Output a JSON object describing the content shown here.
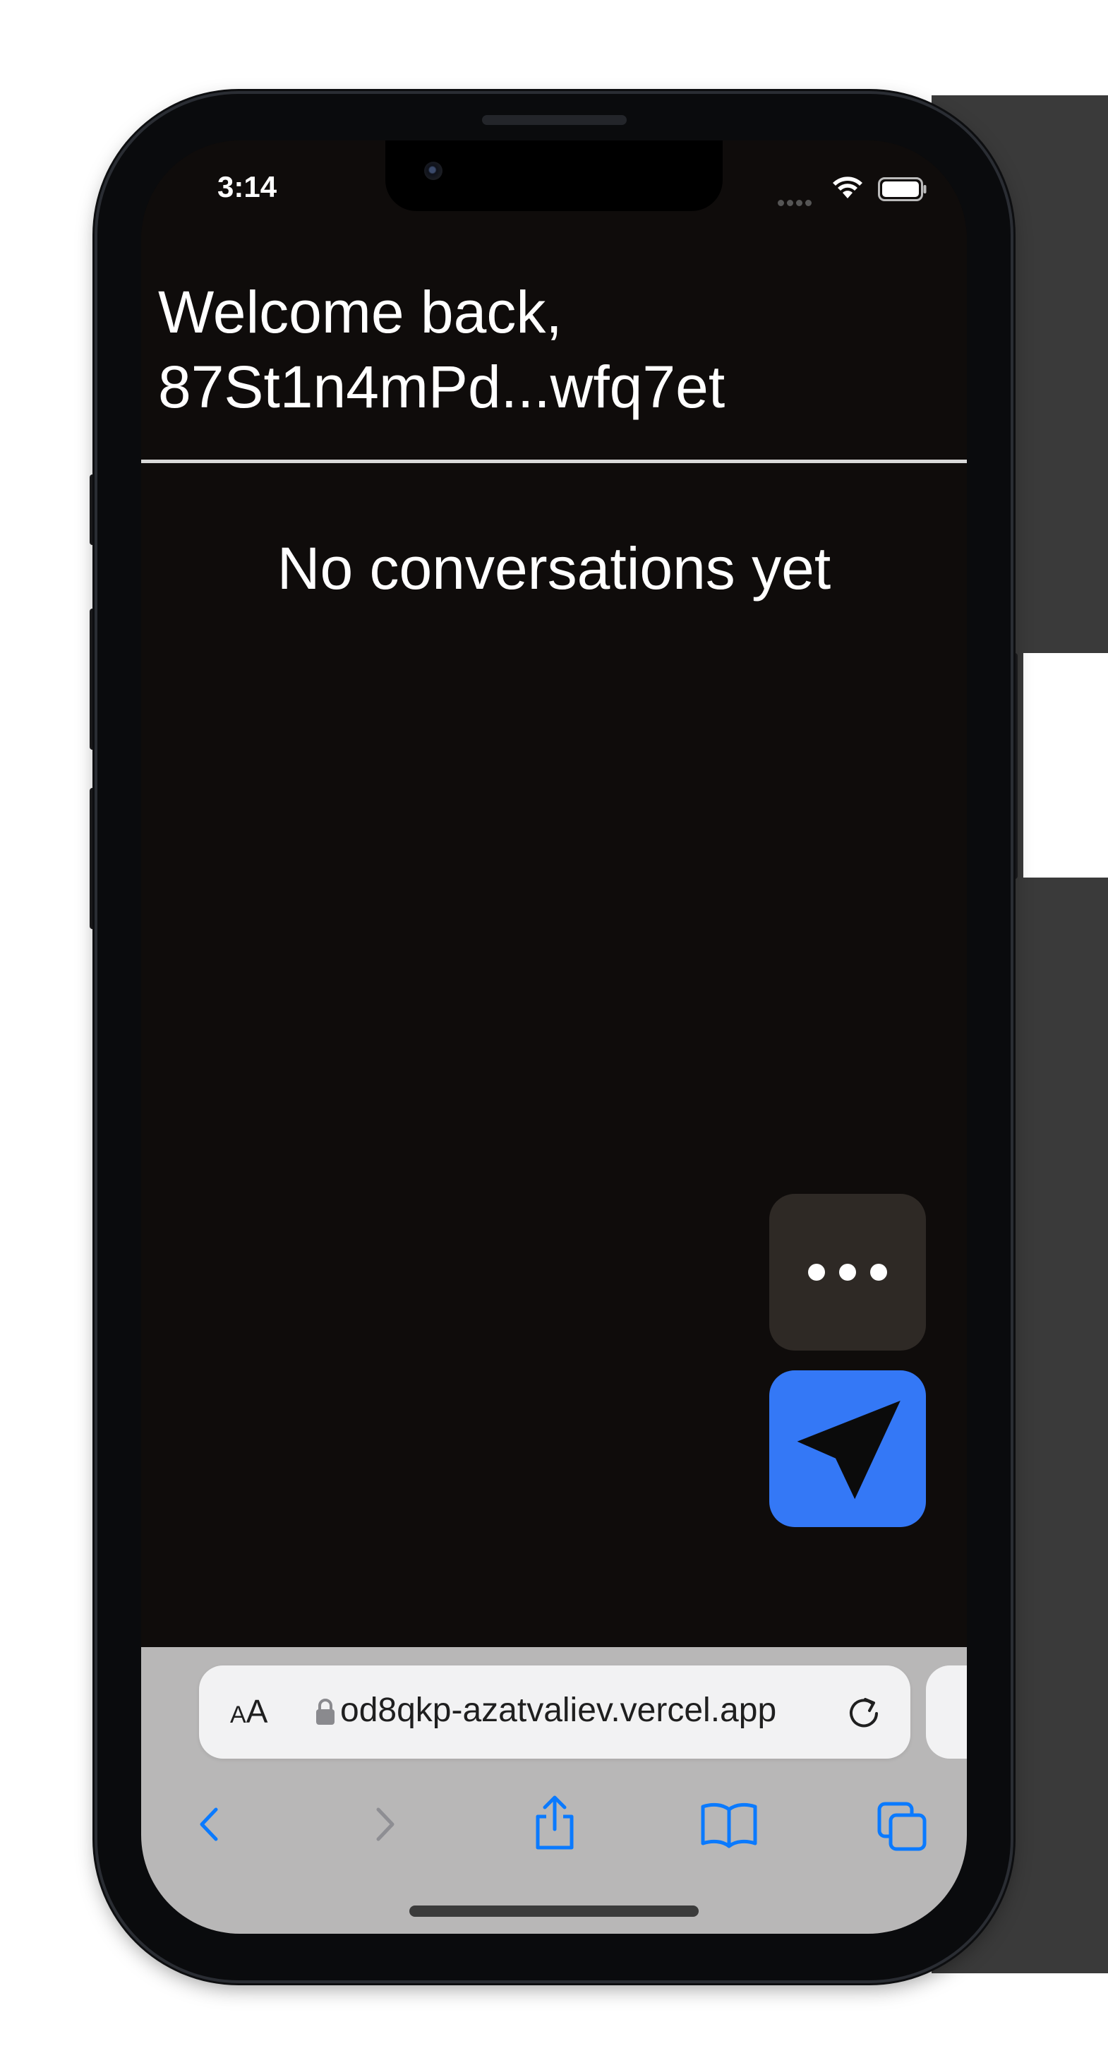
{
  "status_bar": {
    "time": "3:14"
  },
  "header": {
    "welcome_line1": "Welcome back,",
    "welcome_line2": "87St1n4mPd...wfq7et"
  },
  "main": {
    "empty_state": "No conversations yet"
  },
  "fab": {
    "more_icon": "ellipsis-icon",
    "send_icon": "paper-plane-icon"
  },
  "browser": {
    "text_size_label_small": "A",
    "text_size_label_large": "A",
    "url": "od8qkp-azatvaliev.vercel.app",
    "toolbar_icons": [
      "back-icon",
      "forward-icon",
      "share-icon",
      "bookmarks-icon",
      "tabs-icon"
    ]
  },
  "colors": {
    "background": "#0f0c0b",
    "accent": "#3478f6",
    "browser_bar": "#b8b7b7",
    "ios_blue": "#0a7aff"
  }
}
